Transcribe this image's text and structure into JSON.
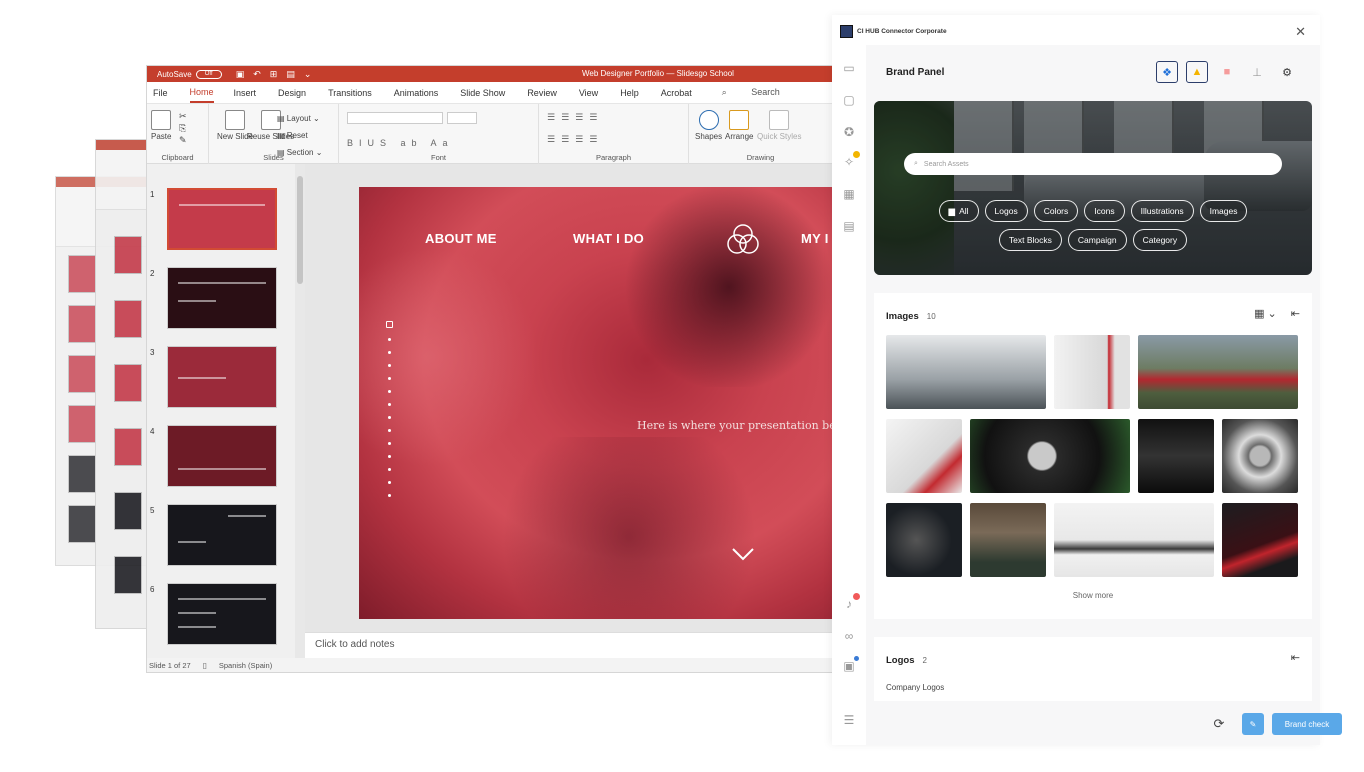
{
  "ppt": {
    "autosave_label": "AutoSave",
    "autosave_state": "Off",
    "doc_title": "Web Designer Portfolio — Slidesgo School",
    "menu": [
      "File",
      "Home",
      "Insert",
      "Design",
      "Transitions",
      "Animations",
      "Slide Show",
      "Review",
      "View",
      "Help",
      "Acrobat"
    ],
    "active_menu": "Home",
    "search_label": "Search",
    "ribbon": {
      "paste": "Paste",
      "new_slide": "New Slide",
      "reuse_slides": "Reuse Slides",
      "layout": "Layout",
      "reset": "Reset",
      "section": "Section",
      "shapes": "Shapes",
      "arrange": "Arrange",
      "quick_styles": "Quick Styles",
      "groups": [
        "Clipboard",
        "Slides",
        "Font",
        "Paragraph",
        "Drawing"
      ]
    },
    "thumb_numbers": [
      "1",
      "2",
      "3",
      "4",
      "5",
      "6"
    ],
    "slide": {
      "nav": [
        "ABOUT ME",
        "WHAT I DO",
        "MY I"
      ],
      "tagline": "Here is where your presentation beg"
    },
    "notes_placeholder": "Click to add notes",
    "status": {
      "slide_counter": "Slide 1 of 27",
      "language": "Spanish (Spain)"
    }
  },
  "panel": {
    "app_name": "CI HUB Connector Corporate",
    "title": "Brand Panel",
    "search_placeholder": "Search Assets",
    "chips_row1": [
      "All",
      "Logos",
      "Colors",
      "Icons",
      "Illustrations",
      "Images"
    ],
    "chips_row2": [
      "Text Blocks",
      "Campaign",
      "Category"
    ],
    "images": {
      "title": "Images",
      "count": "10",
      "show_more": "Show more"
    },
    "logos": {
      "title": "Logos",
      "count": "2",
      "subtitle": "Company Logos"
    },
    "brand_check": "Brand check",
    "colors": {
      "accent": "#5aa8e8",
      "ppt_red": "#c43e2c",
      "navy": "#2c3e6b"
    }
  }
}
